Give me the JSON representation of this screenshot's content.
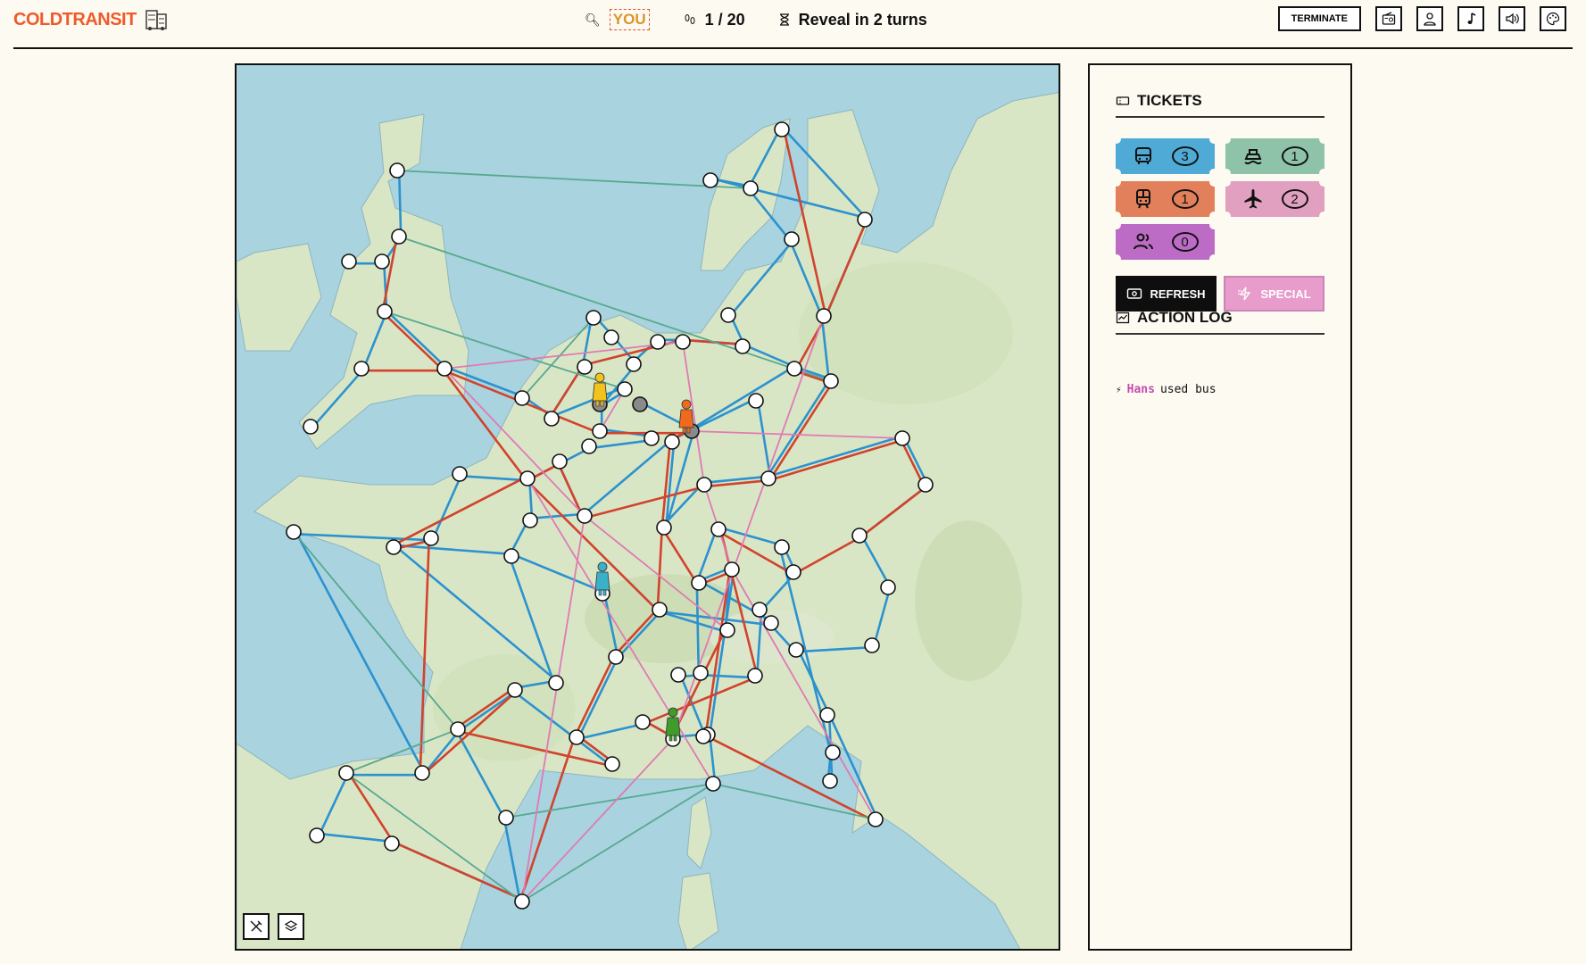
{
  "header": {
    "logo_text": "COLDTRANSIT",
    "player_badge": "YOU",
    "round_text": "1 / 20",
    "reveal_text": "Reveal in 2 turns",
    "terminate_label": "TERMINATE",
    "icon_buttons": [
      "radio-icon",
      "user-icon",
      "music-icon",
      "volume-icon",
      "palette-icon"
    ]
  },
  "map": {
    "controls": [
      "disable-tool-icon",
      "layers-icon"
    ],
    "players_on_map": [
      {
        "color": "#f2c21d"
      },
      {
        "color": "#ef6a1c"
      },
      {
        "color": "#3bb0c9"
      },
      {
        "color": "#3f9b2a"
      }
    ],
    "route_colors": {
      "bus": "#2c92cf",
      "train": "#d1432c",
      "ferry": "#58a98f",
      "flight": "#e07ab3"
    }
  },
  "tickets": {
    "title": "TICKETS",
    "items": [
      {
        "type": "bus",
        "icon": "bus-icon",
        "count": "3",
        "color": "#4faad6"
      },
      {
        "type": "ferry",
        "icon": "ferry-icon",
        "count": "1",
        "color": "#8ec3aa"
      },
      {
        "type": "train",
        "icon": "train-icon",
        "count": "1",
        "color": "#e2805c"
      },
      {
        "type": "flight",
        "icon": "plane-icon",
        "count": "2",
        "color": "#e2a0c0"
      },
      {
        "type": "walk",
        "icon": "people-icon",
        "count": "0",
        "color": "#bd6cc6"
      }
    ],
    "refresh_label": "REFRESH",
    "special_label": "SPECIAL"
  },
  "action_log": {
    "title": "ACTION LOG",
    "entries": [
      {
        "who": "Hans",
        "text": "used bus"
      }
    ]
  }
}
